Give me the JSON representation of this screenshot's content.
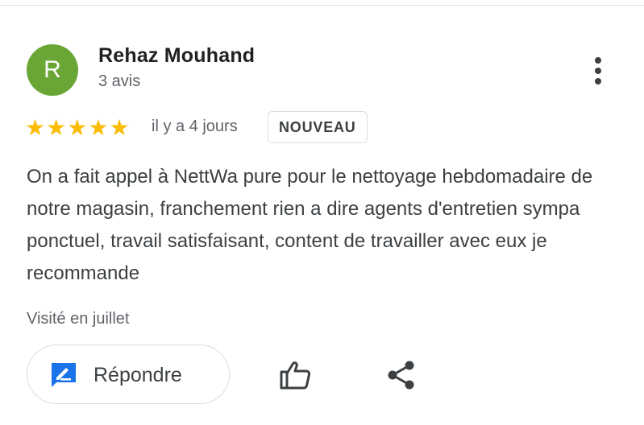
{
  "author": {
    "initial": "R",
    "name": "Rehaz Mouhand",
    "meta": "3 avis",
    "avatar_color": "#6aa636"
  },
  "review": {
    "rating": 5,
    "rating_max": 5,
    "date": "il y a 4 jours",
    "badge": "NOUVEAU",
    "text": "On a fait appel à NettWa pure pour le nettoyage hebdomadaire de notre magasin, franchement rien a dire agents d'entretien sympa ponctuel, travail satisfaisant, content de travailler avec eux je recommande",
    "visit": "Visité en juillet"
  },
  "actions": {
    "reply_label": "Répondre",
    "reply_icon": "reply-edit-icon",
    "like_icon": "thumbs-up-icon",
    "share_icon": "share-icon",
    "more_icon": "more-vert-icon"
  },
  "colors": {
    "star": "#fbbc04",
    "accent_blue": "#1a73e8",
    "text_primary": "#202124",
    "text_secondary": "#5f6368"
  }
}
